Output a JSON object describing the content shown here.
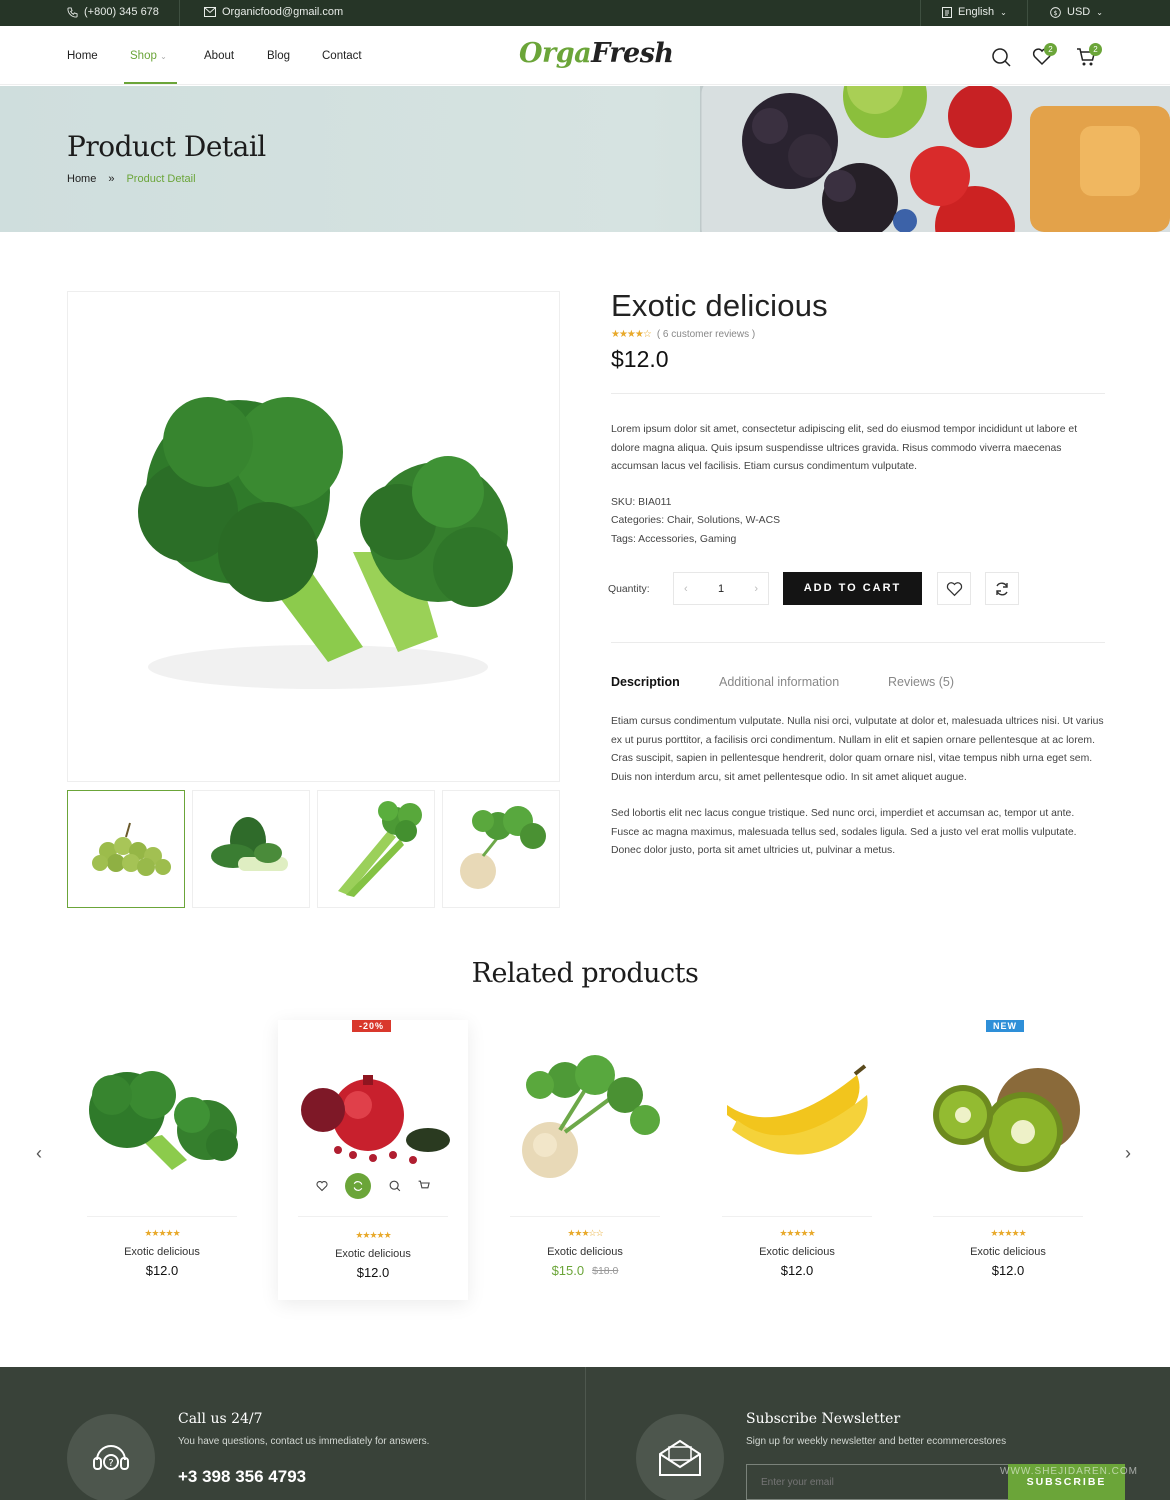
{
  "topbar": {
    "phone": "(+800) 345 678",
    "email": "Organicfood@gmail.com",
    "language": "English",
    "currency": "USD"
  },
  "nav": {
    "items": [
      "Home",
      "Shop",
      "About",
      "Blog",
      "Contact"
    ],
    "logo_part1": "Orga",
    "logo_part2": "Fresh",
    "wishlist_count": "2",
    "cart_count": "2"
  },
  "hero": {
    "title": "Product Detail",
    "crumb_home": "Home",
    "crumb_sep": "»",
    "crumb_current": "Product Detail"
  },
  "product": {
    "title": "Exotic delicious",
    "reviews": "( 6 customer reviews )",
    "rating_stars": "★★★★☆",
    "price": "$12.0",
    "description": "Lorem ipsum dolor sit amet, consectetur adipiscing elit, sed do eiusmod tempor incididunt ut labore et dolore magna aliqua. Quis ipsum suspendisse ultrices gravida. Risus commodo viverra maecenas accumsan lacus vel facilisis. Etiam cursus condimentum vulputate.",
    "sku": "SKU: BIA011",
    "categories": "Categories: Chair, Solutions, W-ACS",
    "tags": "Tags: Accessories, Gaming",
    "quantity_label": "Quantity:",
    "quantity": "1",
    "qty_minus": "‹",
    "qty_plus": "›",
    "add_to_cart": "ADD TO CART"
  },
  "tabs": {
    "items": [
      "Description",
      "Additional information",
      "Reviews (5)"
    ],
    "active": "Description"
  },
  "tab_content": {
    "p1": "Etiam cursus condimentum vulputate. Nulla nisi orci, vulputate at dolor et, malesuada ultrices nisi. Ut varius ex ut purus porttitor, a facilisis orci condimentum. Nullam in elit et sapien ornare pellentesque at ac lorem. Cras suscipit, sapien in pellentesque hendrerit, dolor quam ornare nisl, vitae tempus nibh urna eget sem. Duis non interdum arcu, sit amet pellentesque odio. In sit amet aliquet augue.",
    "p2": "Sed lobortis elit nec lacus congue tristique. Sed nunc orci, imperdiet et accumsan ac, tempor ut ante. Fusce ac magna maximus, malesuada tellus sed, sodales ligula. Sed a justo vel erat mollis vulputate. Donec dolor justo, porta sit amet ultricies ut, pulvinar a metus."
  },
  "related": {
    "heading": "Related products",
    "products": [
      {
        "name": "Exotic delicious",
        "price": "$12.0",
        "stars": "★★★★★"
      },
      {
        "name": "Exotic delicious",
        "price": "$12.0",
        "stars": "★★★★★",
        "badge": "-20%"
      },
      {
        "name": "Exotic delicious",
        "price": "$15.0",
        "old_price": "$18.0",
        "stars": "★★★☆☆"
      },
      {
        "name": "Exotic delicious",
        "price": "$12.0",
        "stars": "★★★★★"
      },
      {
        "name": "Exotic delicious",
        "price": "$12.0",
        "stars": "★★★★★",
        "badge": "NEW"
      }
    ],
    "prev": "‹",
    "next": "›"
  },
  "footer": {
    "call_title": "Call us 24/7",
    "call_text": "You have questions, contact us immediately for answers.",
    "phone": "+3 398 356 4793",
    "news_title": "Subscribe Newsletter",
    "news_text": "Sign up for weekly newsletter and better ecommercestores",
    "email_placeholder": "Enter your email",
    "subscribe": "SUBSCRIBE",
    "watermark": "WWW.SHEJIDAREN.COM"
  },
  "colors": {
    "brand_green": "#6ba539",
    "dark": "#263527",
    "footer": "#394239",
    "sale_red": "#d9382c",
    "new_blue": "#2e8fd8",
    "star": "#e8a92b"
  }
}
